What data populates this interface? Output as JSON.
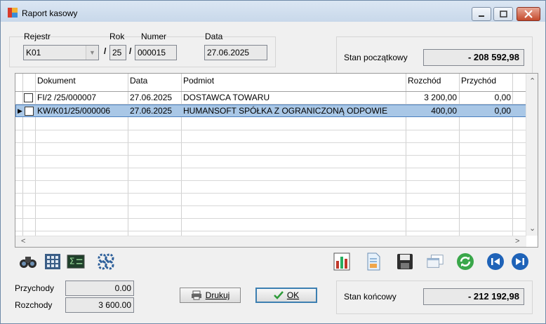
{
  "window": {
    "title": "Raport kasowy"
  },
  "header": {
    "rejestr_label": "Rejestr",
    "rejestr_value": "K01",
    "rok_label": "Rok",
    "rok_value": "25",
    "numer_label": "Numer",
    "numer_value": "000015",
    "data_label": "Data",
    "data_value": "27.06.2025",
    "slash1": "/",
    "slash2": "/"
  },
  "opening": {
    "label": "Stan początkowy",
    "value": "- 208 592,98"
  },
  "table": {
    "columns": [
      "Dokument",
      "Data",
      "Podmiot",
      "Rozchód",
      "Przychód"
    ],
    "rows": [
      {
        "dokument": "FI/2  /25/000007",
        "data": "27.06.2025",
        "podmiot": "DOSTAWCA TOWARU",
        "rozchod": "3 200,00",
        "przychod": "0,00"
      },
      {
        "dokument": "KW/K01/25/000006",
        "data": "27.06.2025",
        "podmiot": "HUMANSOFT SPÓŁKA Z OGRANICZONĄ ODPOWIE",
        "rozchod": "400,00",
        "przychod": "0,00"
      }
    ]
  },
  "totals": {
    "przychody_label": "Przychody",
    "przychody_value": "0.00",
    "rozchody_label": "Rozchody",
    "rozchody_value": "3 600.00"
  },
  "buttons": {
    "print_label": "Drukuj",
    "ok_label": "OK"
  },
  "closing": {
    "label": "Stan końcowy",
    "value": "- 212 192,98"
  },
  "toolbar_icons": [
    "binoculars-icon",
    "calculator-icon",
    "sum-icon",
    "gears-icon",
    "bar-chart-icon",
    "document-icon",
    "save-icon",
    "windows-icon",
    "refresh-icon",
    "previous-icon",
    "next-icon"
  ]
}
